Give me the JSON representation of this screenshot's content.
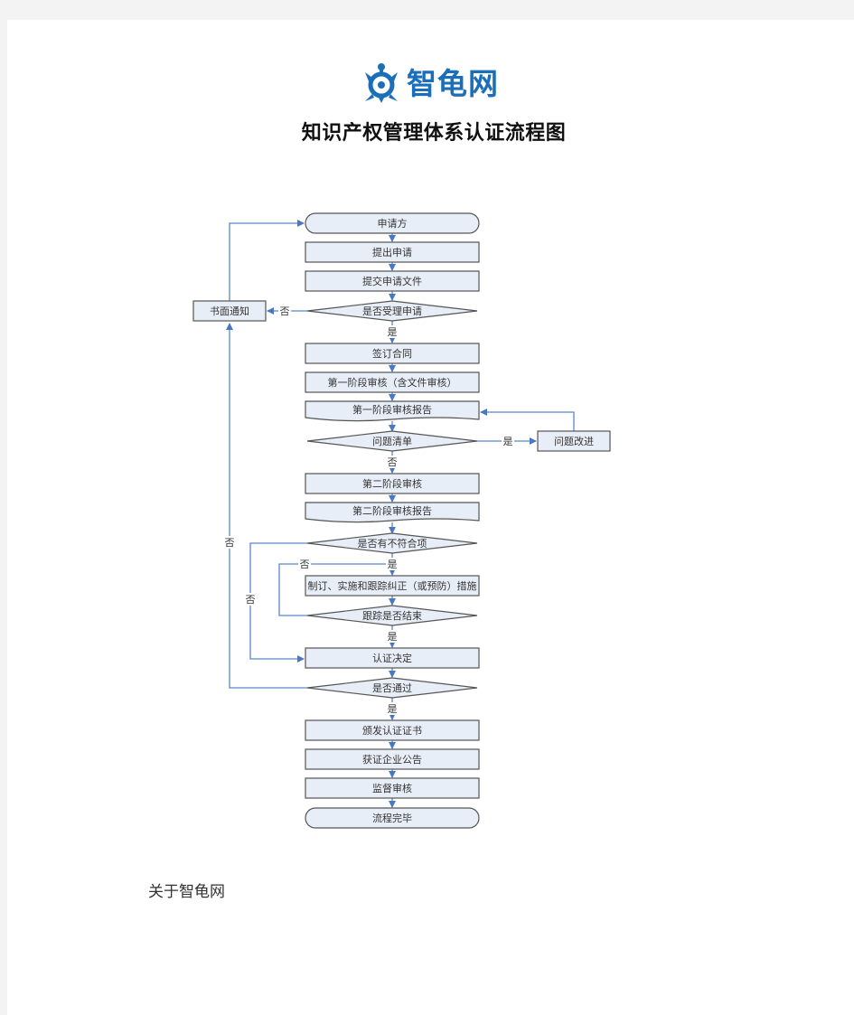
{
  "header": {
    "logo_text": "智龟网",
    "title": "知识产权管理体系认证流程图"
  },
  "flowchart": {
    "nodes": {
      "applicant": "申请方",
      "submit_application": "提出申请",
      "submit_documents": "提交申请文件",
      "accept_decision": "是否受理申请",
      "written_notice": "书面通知",
      "sign_contract": "签订合同",
      "stage1_audit": "第一阶段审核（含文件审核）",
      "stage1_report": "第一阶段审核报告",
      "issue_list": "问题清单",
      "issue_improve": "问题改进",
      "stage2_audit": "第二阶段审核",
      "stage2_report": "第二阶段审核报告",
      "nonconformity": "是否有不符合项",
      "corrective_action": "制订、实施和跟踪纠正（或预防）措施",
      "tracking_done": "跟踪是否结束",
      "cert_decision": "认证决定",
      "pass_decision": "是否通过",
      "issue_certificate": "颁发认证证书",
      "announcement": "获证企业公告",
      "surveillance": "监督审核",
      "end": "流程完毕"
    },
    "labels": {
      "yes": "是",
      "no": "否"
    }
  },
  "footer": {
    "about": "关于智龟网"
  },
  "colors": {
    "brand": "#1a6fb8",
    "node_fill": "#e8eef8",
    "node_border": "#555555",
    "edge": "#5b86c9"
  }
}
